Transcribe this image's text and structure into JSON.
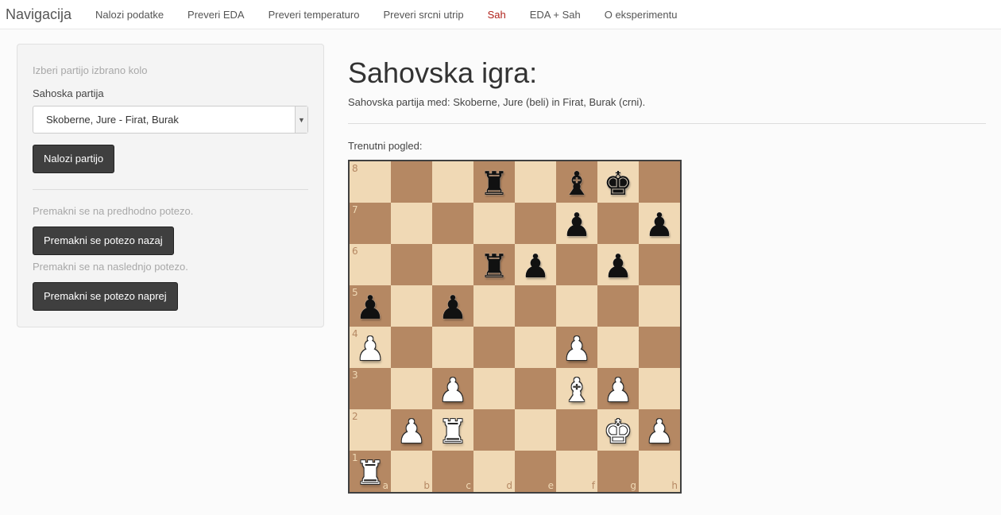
{
  "navbar": {
    "brand": "Navigacija",
    "links": [
      {
        "label": "Nalozi podatke",
        "active": false
      },
      {
        "label": "Preveri EDA",
        "active": false
      },
      {
        "label": "Preveri temperaturo",
        "active": false
      },
      {
        "label": "Preveri srcni utrip",
        "active": false
      },
      {
        "label": "Sah",
        "active": true
      },
      {
        "label": "EDA + Sah",
        "active": false
      },
      {
        "label": "O eksperimentu",
        "active": false
      }
    ],
    "active_color": "#b0221b"
  },
  "sidebar": {
    "round_help": "Izberi partijo izbrano kolo",
    "game_label": "Sahoska partija",
    "game_select_value": "Skoberne, Jure - Firat, Burak",
    "load_button": "Nalozi partijo",
    "prev_help": "Premakni se na predhodno potezo.",
    "prev_button": "Premakni se potezo nazaj",
    "next_help": "Premakni se na naslednjo potezo.",
    "next_button": "Premakni se potezo naprej"
  },
  "main": {
    "title": "Sahovska igra:",
    "subtitle": "Sahovska partija med: Skoberne, Jure (beli) in Firat, Burak (crni).",
    "view_label": "Trenutni pogled:"
  },
  "board": {
    "files": [
      "a",
      "b",
      "c",
      "d",
      "e",
      "f",
      "g",
      "h"
    ],
    "ranks": [
      "8",
      "7",
      "6",
      "5",
      "4",
      "3",
      "2",
      "1"
    ],
    "light_color": "#f0d9b5",
    "dark_color": "#b58863",
    "position": [
      [
        "",
        "",
        "",
        "r",
        "",
        "b",
        "k",
        ""
      ],
      [
        "",
        "",
        "",
        "",
        "",
        "p",
        "",
        "p"
      ],
      [
        "",
        "",
        "",
        "r",
        "p",
        "",
        "p",
        ""
      ],
      [
        "p",
        "",
        "p",
        "",
        "",
        "",
        "",
        ""
      ],
      [
        "P",
        "",
        "",
        "",
        "",
        "P",
        "",
        ""
      ],
      [
        "",
        "",
        "P",
        "",
        "",
        "B",
        "P",
        ""
      ],
      [
        "",
        "P",
        "R",
        "",
        "",
        "",
        "K",
        "P"
      ],
      [
        "R",
        "",
        "",
        "",
        "",
        "",
        "",
        ""
      ]
    ]
  }
}
